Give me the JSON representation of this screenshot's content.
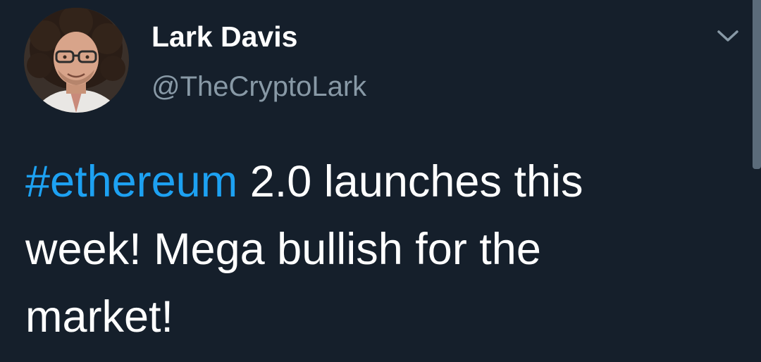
{
  "tweet": {
    "author": {
      "display_name": "Lark Davis",
      "handle": "@TheCryptoLark"
    },
    "text": {
      "hashtag": "#ethereum",
      "line1_rest": " 2.0 launches this",
      "line2": "week! Mega bullish for the",
      "line3": "market!"
    },
    "icons": {
      "menu": "chevron-down-icon",
      "avatar": "profile-photo"
    }
  },
  "colors": {
    "background": "#151f2b",
    "text": "#ffffff",
    "handle": "#8899a6",
    "hashtag": "#1da1f2"
  }
}
